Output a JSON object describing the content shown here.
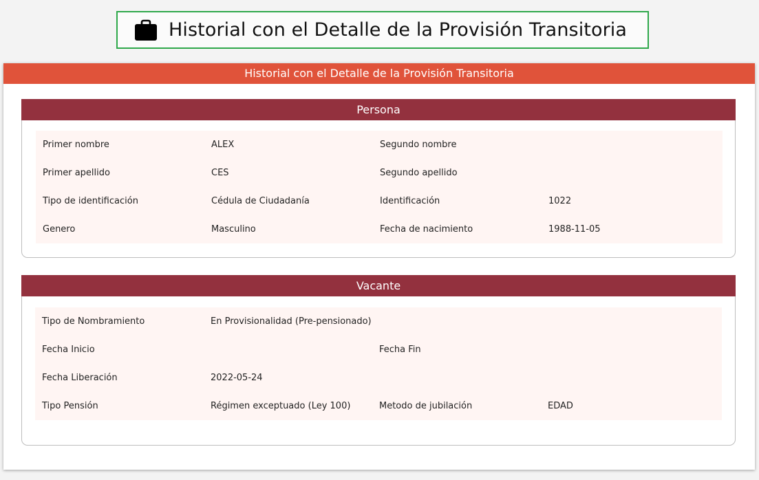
{
  "page": {
    "title": "Historial con el Detalle de la Provisión Transitoria",
    "icon": "briefcase-icon"
  },
  "card": {
    "header": "Historial con el Detalle de la Provisión Transitoria"
  },
  "persona": {
    "header": "Persona",
    "rows": [
      [
        "Primer nombre",
        "ALEX",
        "Segundo nombre",
        ""
      ],
      [
        "Primer apellido",
        "CES",
        "Segundo apellido",
        ""
      ],
      [
        "Tipo de identificación",
        "Cédula de Ciudadanía",
        "Identificación",
        "1022"
      ],
      [
        "Genero",
        "Masculino",
        "Fecha de nacimiento",
        "1988-11-05"
      ]
    ]
  },
  "vacante": {
    "header": "Vacante",
    "rows": [
      [
        "Tipo de Nombramiento",
        "En Provisionalidad (Pre-pensionado)",
        "",
        ""
      ],
      [
        "Fecha Inicio",
        "",
        "Fecha Fin",
        ""
      ],
      [
        "Fecha Liberación",
        "2022-05-24",
        "",
        ""
      ],
      [
        "Tipo Pensión",
        "Régimen exceptuado (Ley 100)",
        "Metodo de jubilación",
        "EDAD"
      ]
    ]
  },
  "colors": {
    "title_border": "#2ea84a",
    "main_header": "#e0533a",
    "section_header": "#93313e",
    "grid_bg": "#fff5f3"
  }
}
